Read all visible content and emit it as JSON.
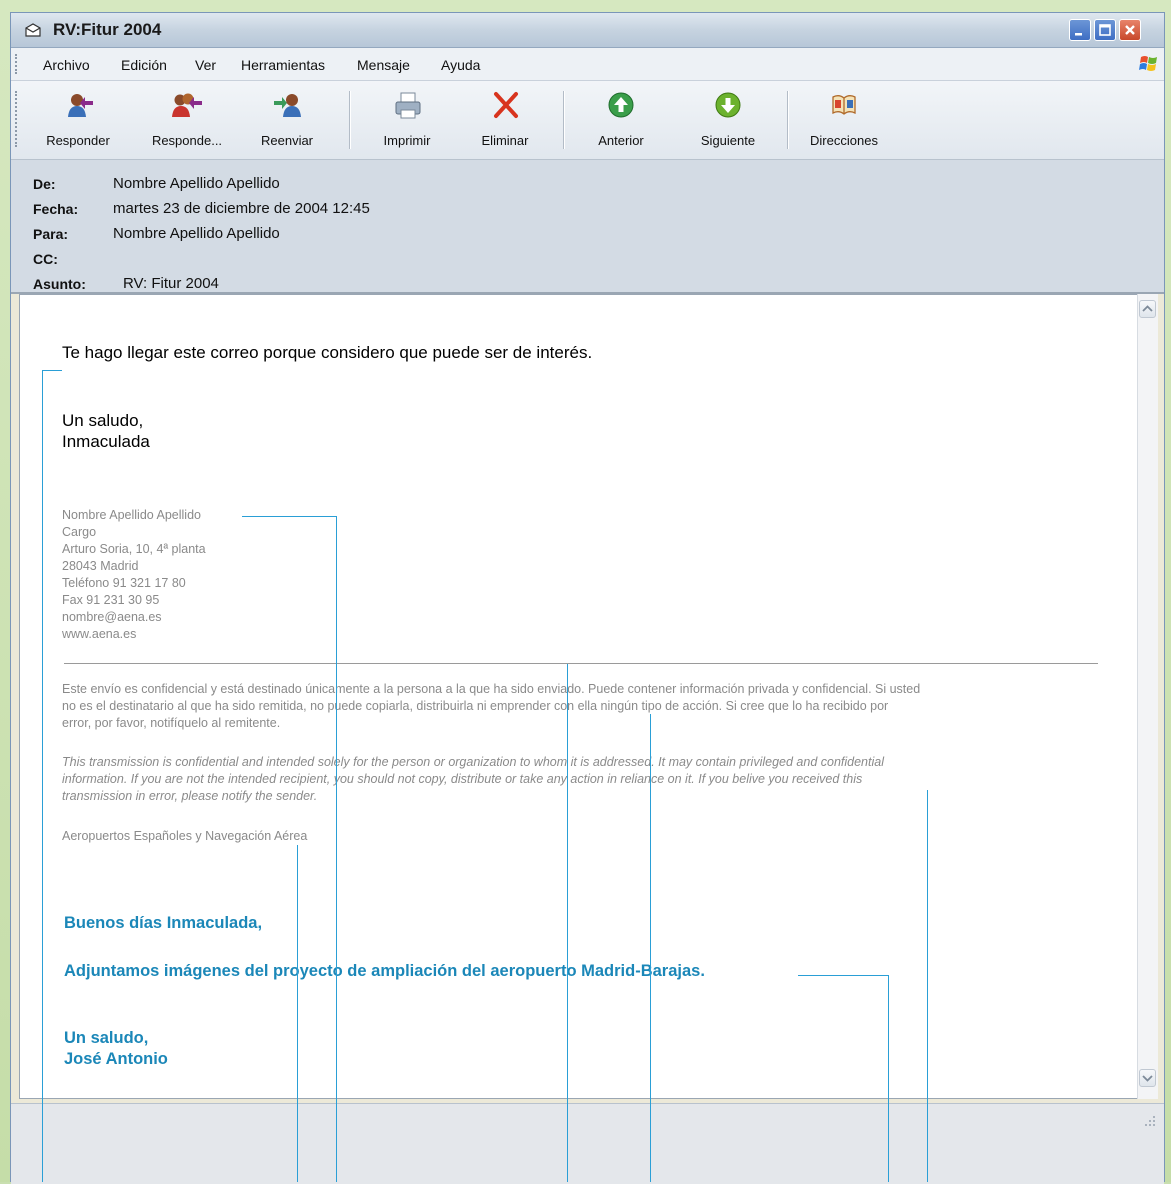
{
  "window": {
    "title": "RV:Fitur 2004"
  },
  "menu": [
    "Archivo",
    "Edición",
    "Ver",
    "Herramientas",
    "Mensaje",
    "Ayuda"
  ],
  "toolbar": {
    "reply": "Responder",
    "reply_all": "Responde...",
    "forward": "Reenviar",
    "print": "Imprimir",
    "delete": "Eliminar",
    "previous": "Anterior",
    "next": "Siguiente",
    "addresses": "Direcciones"
  },
  "header": {
    "from_label": "De:",
    "from": "Nombre Apellido Apellido",
    "date_label": "Fecha:",
    "date": "martes 23 de diciembre de 2004  12:45",
    "to_label": "Para:",
    "to": "Nombre Apellido Apellido",
    "cc_label": "CC:",
    "cc": "",
    "subject_label": "Asunto:",
    "subject": "RV: Fitur 2004"
  },
  "message": {
    "intro": "Te hago llegar este correo porque considero que puede ser de interés.",
    "greeting": "Un saludo,",
    "sender": "Inmaculada"
  },
  "signature": {
    "name": "Nombre Apellido Apellido",
    "role": "Cargo",
    "address": "Arturo Soria, 10, 4ª planta",
    "city": "28043 Madrid",
    "phone": "Teléfono 91 321 17 80",
    "fax": "Fax 91 231 30 95",
    "email": "nombre@aena.es",
    "web": "www.aena.es"
  },
  "disclaimer": {
    "es_1": "Este envío es confidencial y está destinado únicamente a la persona a la que ha sido enviado. Puede contener información privada y confidencial. Si usted",
    "es_2": "no es el destinatario al que ha sido remitida, no puede copiarla, distribuirla ni emprender con ella ningún tipo de acción. Si cree que lo ha recibido por",
    "es_3": "error, por favor, notifíquelo al remitente.",
    "en_1": "This transmission is confidential and intended solely for the person or organization to whom it is addressed. It may contain privileged and confidential",
    "en_2": "information. If you are not the intended recipient, you should not copy, distribute or take any action in reliance on it. If you belive you received this",
    "en_3": "transmission in error, please notify the sender.",
    "company": "Aeropuertos Españoles y Navegación Aérea"
  },
  "forwarded": {
    "greeting": "Buenos días Inmaculada,",
    "body": "Adjuntamos imágenes del proyecto de ampliación del aeropuerto Madrid-Barajas.",
    "closing": "Un saludo,",
    "sender": "José Antonio"
  },
  "colors": {
    "accent_blue": "#1b87b8",
    "callout_line": "#2a9fd6"
  }
}
